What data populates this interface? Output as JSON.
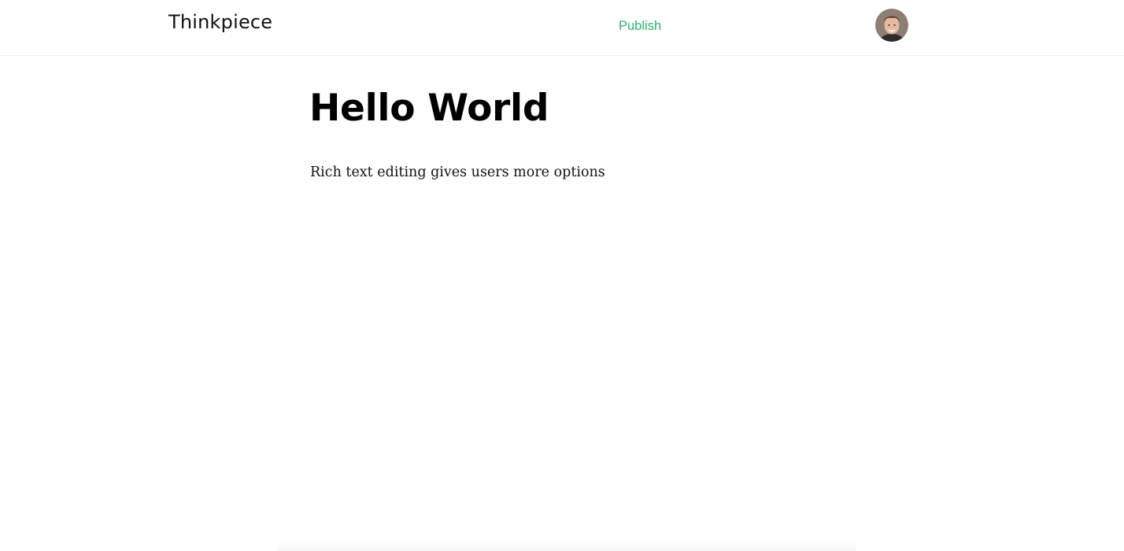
{
  "header": {
    "brand": "Thinkpiece",
    "publish_label": "Publish",
    "accent_color": "#2bb36b"
  },
  "avatar": {
    "icon": "user-avatar-photo"
  },
  "editor": {
    "title": "Hello World",
    "body": "Rich text editing gives users more options"
  }
}
